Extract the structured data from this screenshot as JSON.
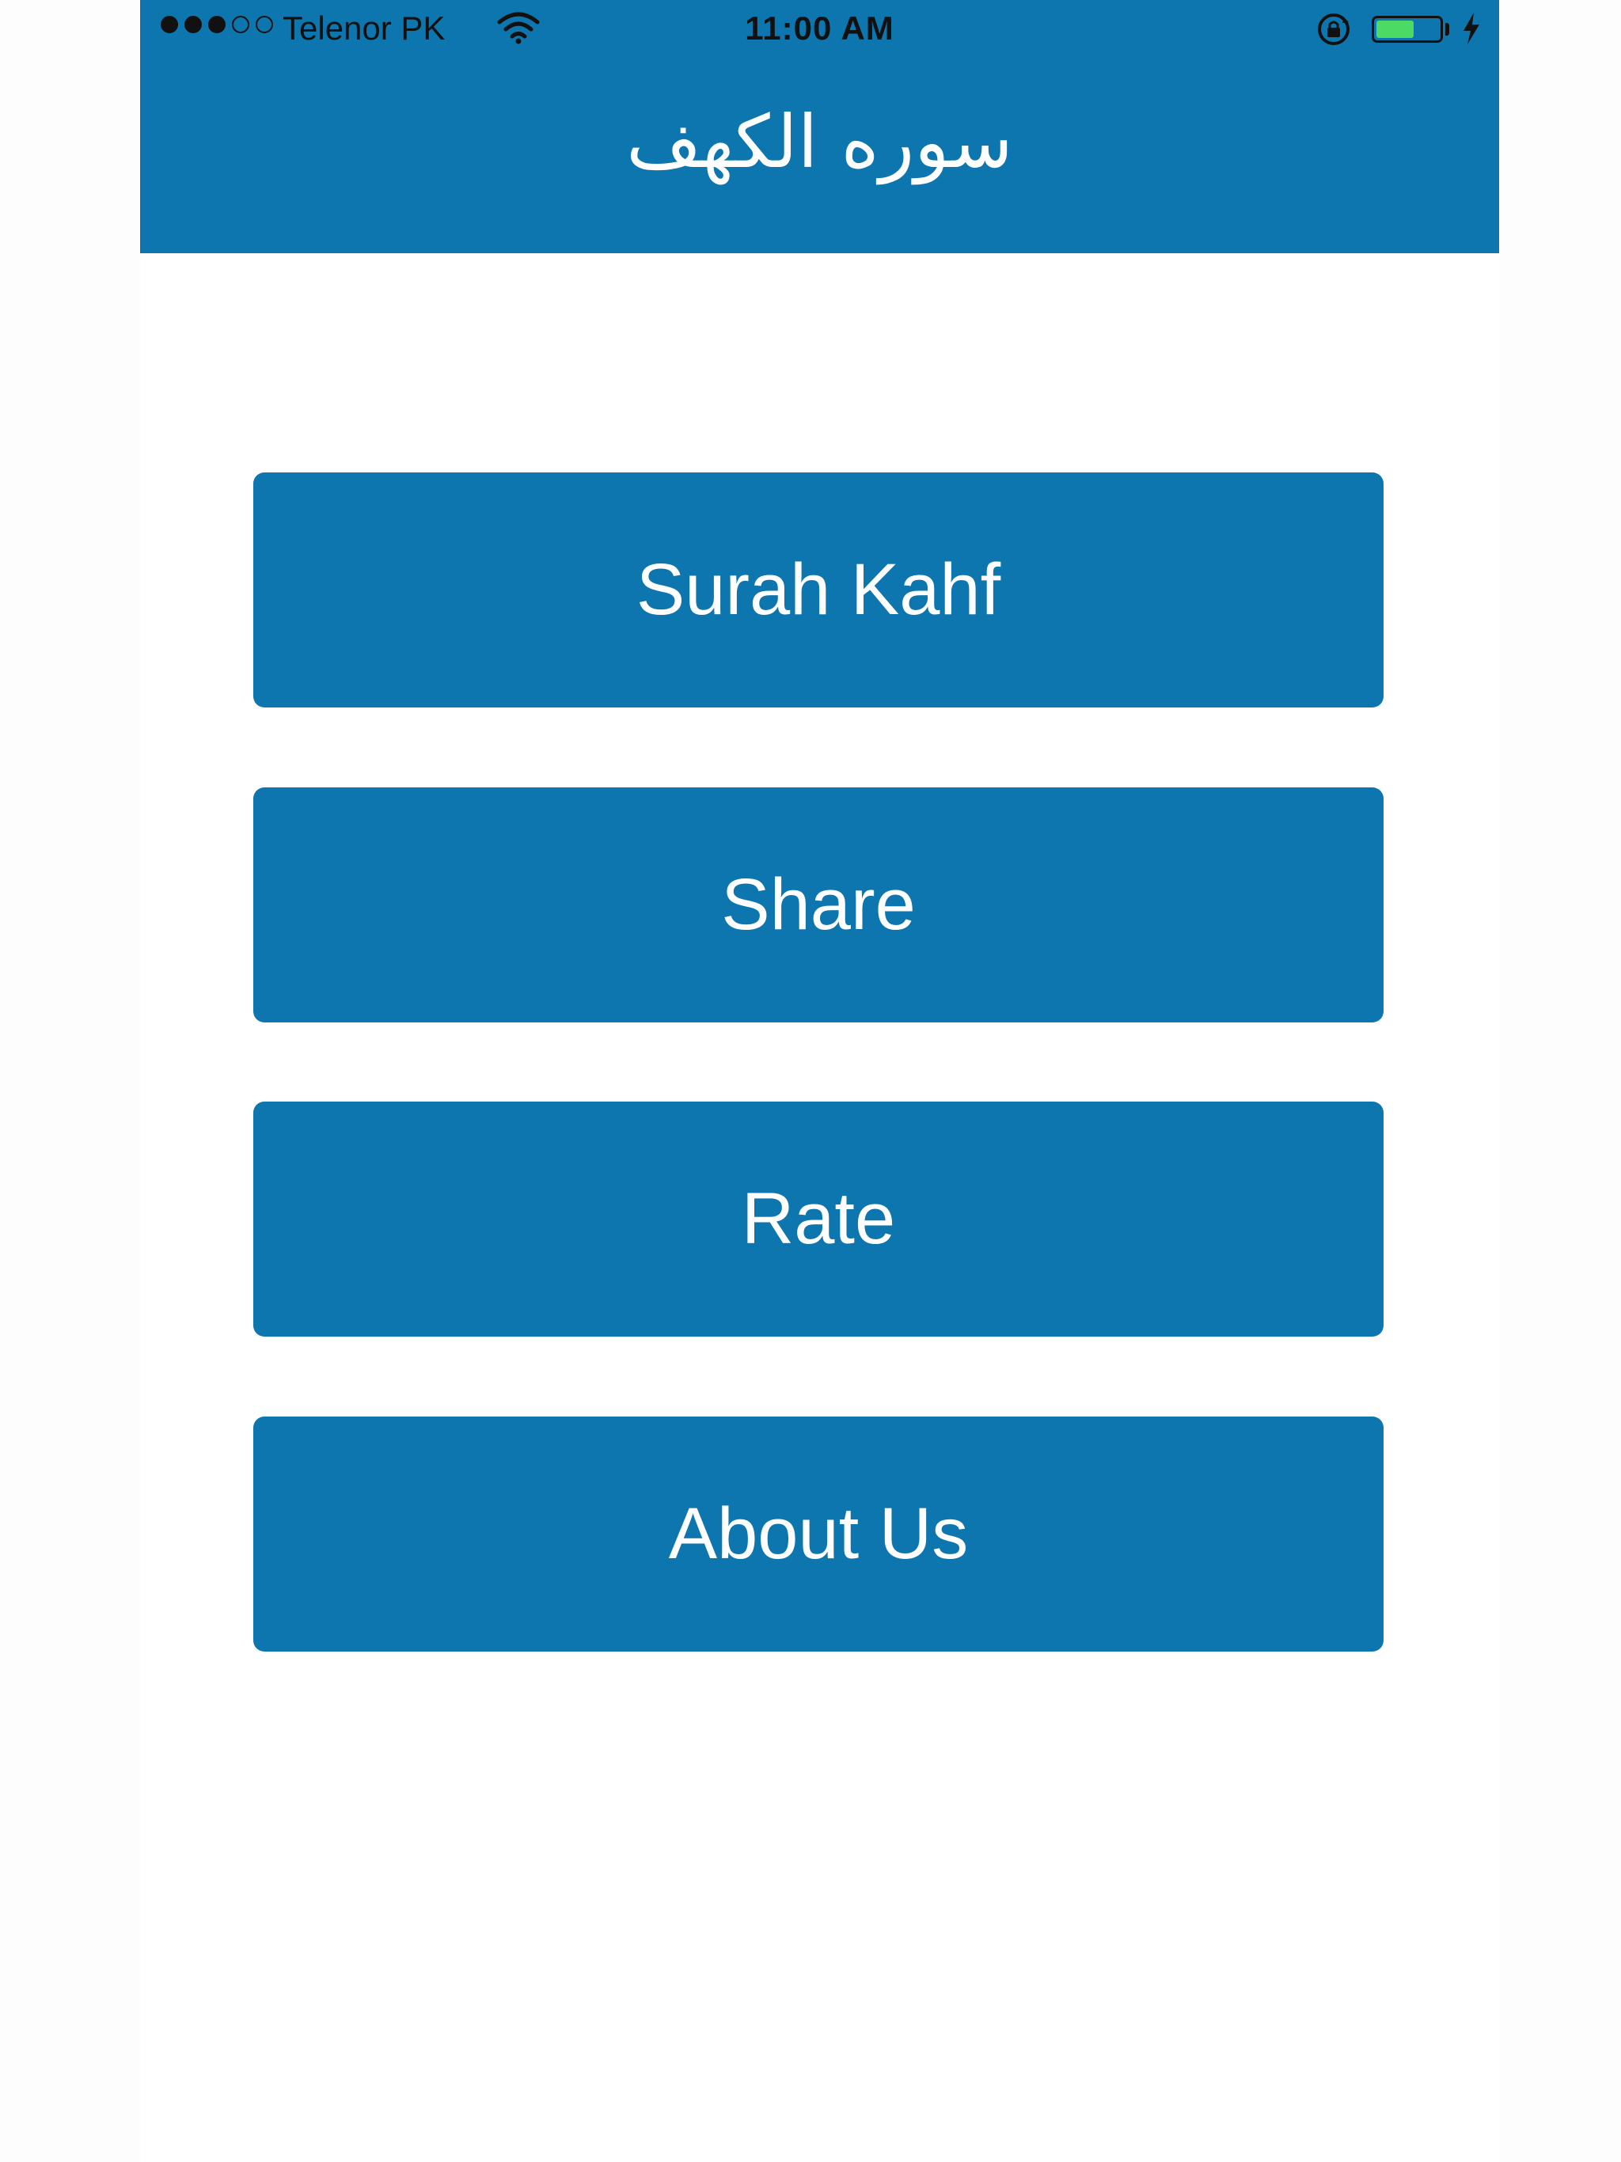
{
  "status_bar": {
    "carrier": "Telenor PK",
    "time": "11:00 AM",
    "signal": {
      "filled": 3,
      "total": 5
    },
    "battery_level": 0.6
  },
  "header": {
    "title": "سوره الكهف"
  },
  "menu": {
    "buttons": [
      {
        "label": "Surah Kahf"
      },
      {
        "label": "Share"
      },
      {
        "label": "Rate"
      },
      {
        "label": "About Us"
      }
    ]
  },
  "colors": {
    "primary": "#0d76ae",
    "battery": "#4cd964",
    "background": "#ffffff"
  },
  "icons": [
    "signal-dots-icon",
    "wifi-icon",
    "orientation-lock-icon",
    "battery-icon",
    "charging-bolt-icon"
  ]
}
